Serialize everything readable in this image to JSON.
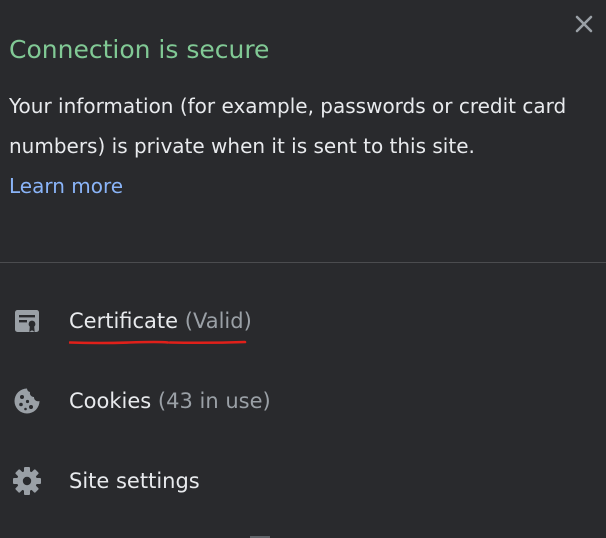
{
  "header": {
    "title": "Connection is secure",
    "description": "Your information (for example, passwords or credit card numbers) is private when it is sent to this site.",
    "learn_more": "Learn more"
  },
  "close": {
    "icon": "close-icon"
  },
  "items": [
    {
      "icon": "certificate-icon",
      "label": "Certificate",
      "status": "(Valid)"
    },
    {
      "icon": "cookie-icon",
      "label": "Cookies",
      "status": "(43 in use)"
    },
    {
      "icon": "gear-icon",
      "label": "Site settings",
      "status": ""
    }
  ],
  "colors": {
    "background": "#292a2d",
    "secure_green": "#81c995",
    "link_blue": "#8ab4f8",
    "text": "#e8eaed",
    "muted": "#9aa0a6",
    "annotation_red": "#e0201a"
  }
}
